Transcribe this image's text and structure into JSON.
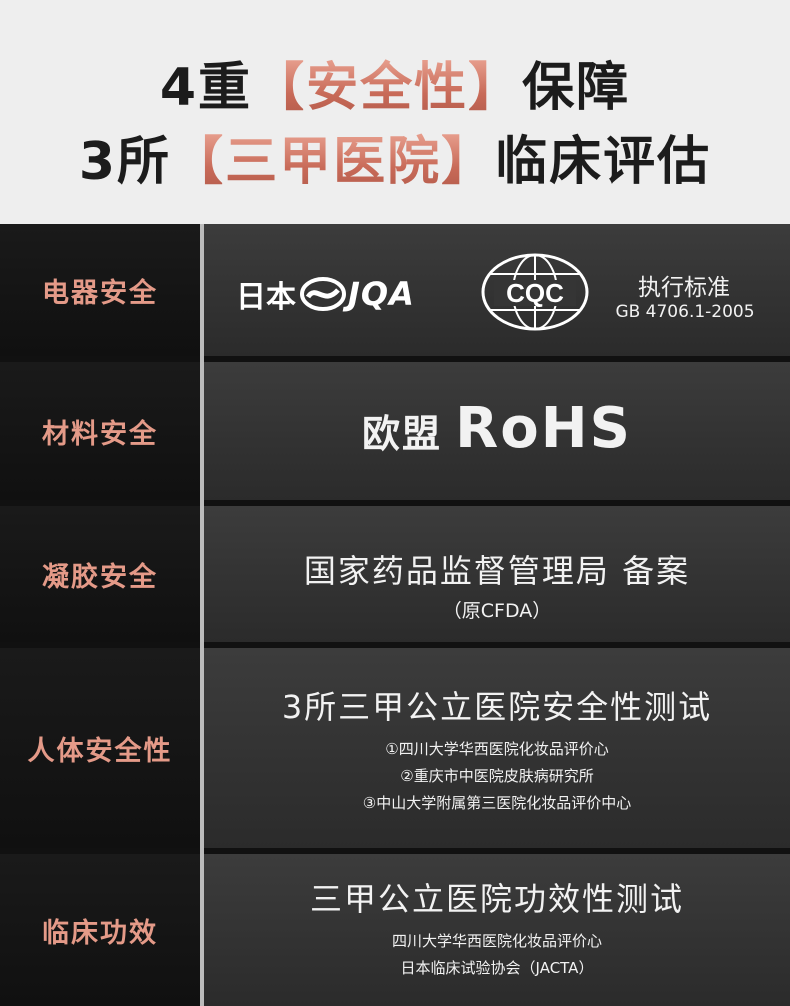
{
  "header": {
    "line1": {
      "prefix": "4重",
      "bracket_open": "【",
      "highlight": "安全性",
      "bracket_close": "】",
      "suffix": "保障"
    },
    "line2": {
      "prefix": "3所",
      "bracket_open": "【",
      "highlight": "三甲医院",
      "bracket_close": "】",
      "suffix": "临床评估"
    }
  },
  "rows": [
    {
      "label": "电器安全",
      "jqa_prefix": "日本",
      "jqa_icon": "jqa-logo-icon",
      "jqa_text": "JQA",
      "cqc_icon": "cqc-logo-icon",
      "cqc_text": "CQC",
      "standard_title": "执行标准",
      "standard_code": "GB 4706.1-2005"
    },
    {
      "label": "材料安全",
      "text_cn": "欧盟",
      "text_en": "RoHS"
    },
    {
      "label": "凝胶安全",
      "title": "国家药品监督管理局 备案",
      "subtitle": "（原CFDA）"
    },
    {
      "label": "人体安全性",
      "title": "3所三甲公立医院安全性测试",
      "items": [
        "①四川大学华西医院化妆品评价心",
        "②重庆市中医院皮肤病研究所",
        "③中山大学附属第三医院化妆品评价中心"
      ]
    },
    {
      "label": "临床功效",
      "title": "三甲公立医院功效性测试",
      "items": [
        "四川大学华西医院化妆品评价心",
        "日本临床试验协会（JACTA）"
      ]
    }
  ],
  "colors": {
    "accent": "#e49a88",
    "header_bg": "#eeeeee",
    "label_bg": "#141414",
    "content_bg": "#333333"
  }
}
